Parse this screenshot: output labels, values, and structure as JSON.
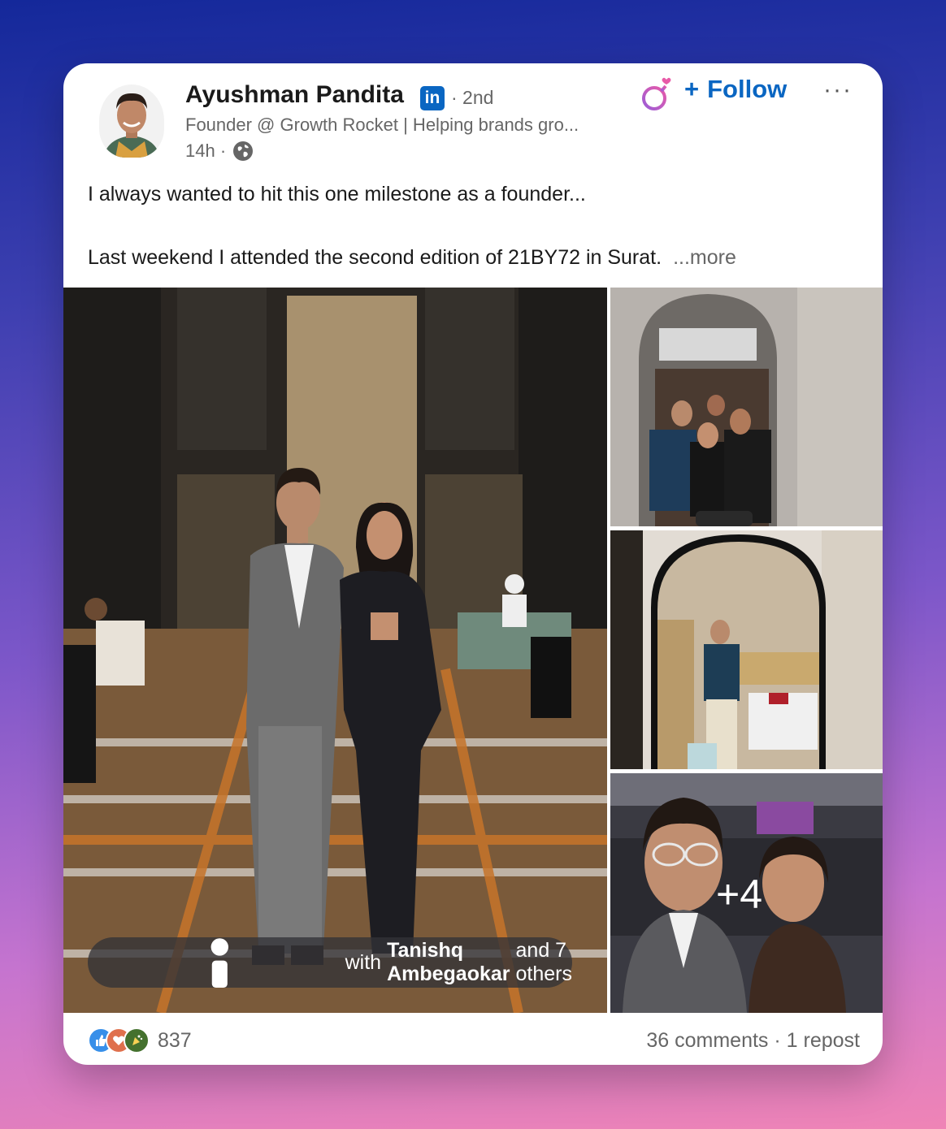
{
  "author": {
    "name": "Ayushman Pandita",
    "badge": "in",
    "degree": "· 2nd",
    "headline": "Founder @ Growth Rocket | Helping brands gro...",
    "time": "14h ·"
  },
  "actions": {
    "follow_plus": "+",
    "follow_label": "Follow",
    "more_menu": "···"
  },
  "post": {
    "line1": "I always wanted to hit this one milestone as a founder...",
    "line2": "Last weekend I attended the second edition of 21BY72 in Surat.",
    "see_more": "...more"
  },
  "media": {
    "tag_prefix": "with",
    "tag_name": "Tanishq Ambegaokar",
    "tag_suffix": "and 7 others",
    "extra_count": "+4"
  },
  "social": {
    "reaction_count": "837",
    "comments": "36 comments",
    "separator": " · ",
    "reposts": "1 repost"
  },
  "colors": {
    "brand": "#0a66c2",
    "text": "#1a1a1a",
    "muted": "#666666"
  },
  "icons": [
    "linkedin-badge-icon",
    "globe-icon",
    "gender-icon",
    "person-icon",
    "like-icon",
    "love-icon",
    "celebrate-icon"
  ]
}
